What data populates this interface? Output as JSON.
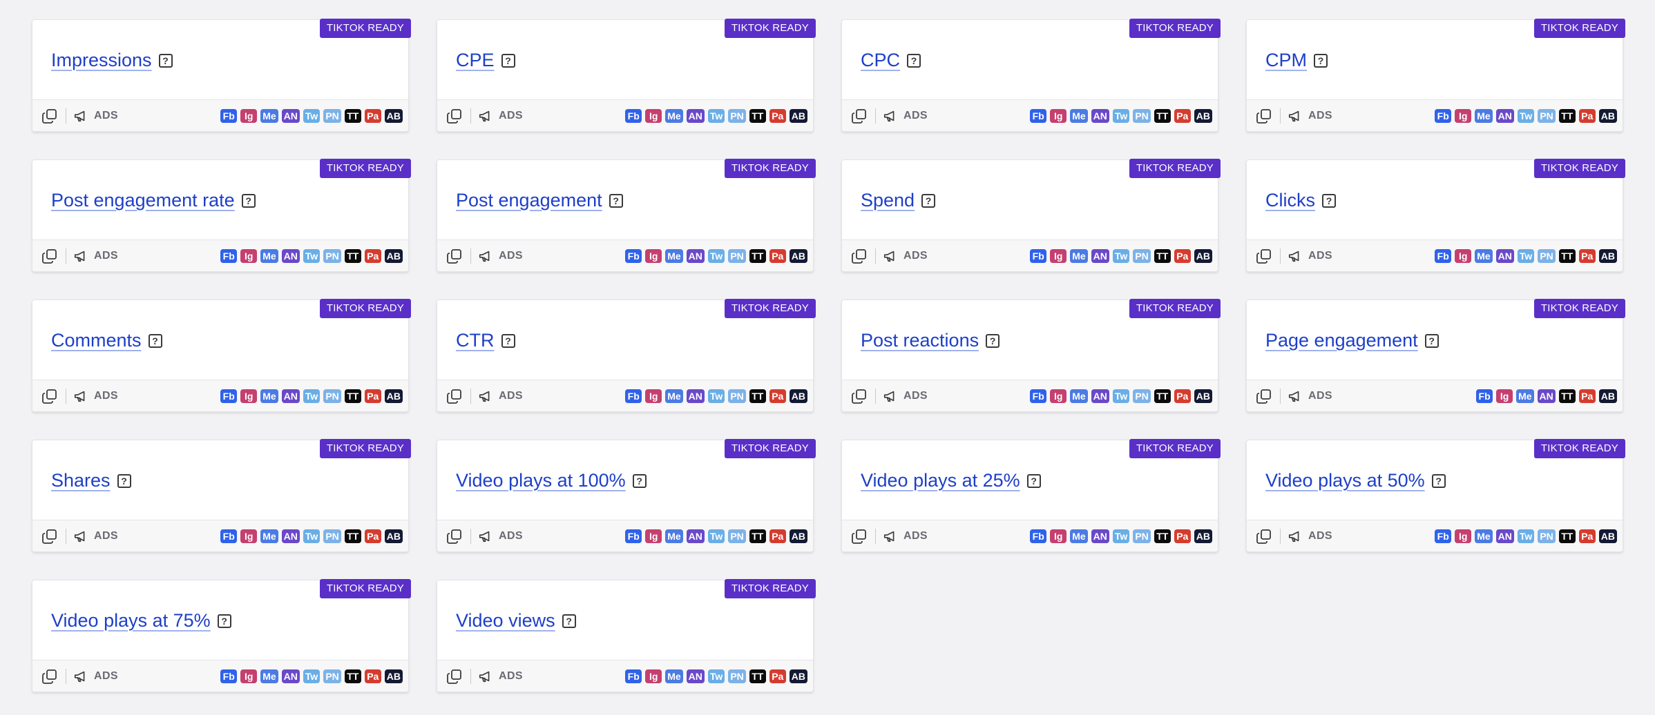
{
  "badge_text": "TIKTOK READY",
  "category_label": "ADS",
  "platforms": [
    {
      "code": "Fb",
      "color": "#2f62ea"
    },
    {
      "code": "Ig",
      "color": "#c5406f"
    },
    {
      "code": "Me",
      "color": "#4b7be3"
    },
    {
      "code": "AN",
      "color": "#6a49c8"
    },
    {
      "code": "Tw",
      "color": "#6aaee6"
    },
    {
      "code": "PN",
      "color": "#7db2e8"
    },
    {
      "code": "TT",
      "color": "#0b0b0b"
    },
    {
      "code": "Pa",
      "color": "#d53c2f"
    },
    {
      "code": "AB",
      "color": "#141a33"
    }
  ],
  "cards": [
    {
      "title": "Impressions",
      "platforms": [
        "Fb",
        "Ig",
        "Me",
        "AN",
        "Tw",
        "PN",
        "TT",
        "Pa",
        "AB"
      ]
    },
    {
      "title": "CPE",
      "platforms": [
        "Fb",
        "Ig",
        "Me",
        "AN",
        "Tw",
        "PN",
        "TT",
        "Pa",
        "AB"
      ]
    },
    {
      "title": "CPC",
      "platforms": [
        "Fb",
        "Ig",
        "Me",
        "AN",
        "Tw",
        "PN",
        "TT",
        "Pa",
        "AB"
      ]
    },
    {
      "title": "CPM",
      "platforms": [
        "Fb",
        "Ig",
        "Me",
        "AN",
        "Tw",
        "PN",
        "TT",
        "Pa",
        "AB"
      ]
    },
    {
      "title": "Post engagement rate",
      "platforms": [
        "Fb",
        "Ig",
        "Me",
        "AN",
        "Tw",
        "PN",
        "TT",
        "Pa",
        "AB"
      ]
    },
    {
      "title": "Post engagement",
      "platforms": [
        "Fb",
        "Ig",
        "Me",
        "AN",
        "Tw",
        "PN",
        "TT",
        "Pa",
        "AB"
      ]
    },
    {
      "title": "Spend",
      "platforms": [
        "Fb",
        "Ig",
        "Me",
        "AN",
        "Tw",
        "PN",
        "TT",
        "Pa",
        "AB"
      ]
    },
    {
      "title": "Clicks",
      "platforms": [
        "Fb",
        "Ig",
        "Me",
        "AN",
        "Tw",
        "PN",
        "TT",
        "Pa",
        "AB"
      ]
    },
    {
      "title": "Comments",
      "platforms": [
        "Fb",
        "Ig",
        "Me",
        "AN",
        "Tw",
        "PN",
        "TT",
        "Pa",
        "AB"
      ]
    },
    {
      "title": "CTR",
      "platforms": [
        "Fb",
        "Ig",
        "Me",
        "AN",
        "Tw",
        "PN",
        "TT",
        "Pa",
        "AB"
      ]
    },
    {
      "title": "Post reactions",
      "platforms": [
        "Fb",
        "Ig",
        "Me",
        "AN",
        "Tw",
        "PN",
        "TT",
        "Pa",
        "AB"
      ]
    },
    {
      "title": "Page engagement",
      "platforms": [
        "Fb",
        "Ig",
        "Me",
        "AN",
        "TT",
        "Pa",
        "AB"
      ]
    },
    {
      "title": "Shares",
      "platforms": [
        "Fb",
        "Ig",
        "Me",
        "AN",
        "Tw",
        "PN",
        "TT",
        "Pa",
        "AB"
      ]
    },
    {
      "title": "Video plays at 100%",
      "platforms": [
        "Fb",
        "Ig",
        "Me",
        "AN",
        "Tw",
        "PN",
        "TT",
        "Pa",
        "AB"
      ]
    },
    {
      "title": "Video plays at 25%",
      "platforms": [
        "Fb",
        "Ig",
        "Me",
        "AN",
        "Tw",
        "PN",
        "TT",
        "Pa",
        "AB"
      ]
    },
    {
      "title": "Video plays at 50%",
      "platforms": [
        "Fb",
        "Ig",
        "Me",
        "AN",
        "Tw",
        "PN",
        "TT",
        "Pa",
        "AB"
      ]
    },
    {
      "title": "Video plays at 75%",
      "platforms": [
        "Fb",
        "Ig",
        "Me",
        "AN",
        "Tw",
        "PN",
        "TT",
        "Pa",
        "AB"
      ]
    },
    {
      "title": "Video views",
      "platforms": [
        "Fb",
        "Ig",
        "Me",
        "AN",
        "Tw",
        "PN",
        "TT",
        "Pa",
        "AB"
      ]
    }
  ]
}
